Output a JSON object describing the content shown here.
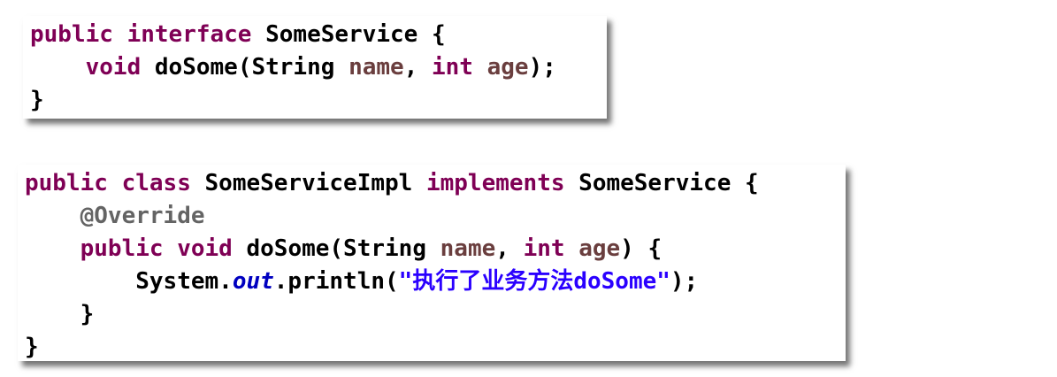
{
  "colors": {
    "keyword": "#7f0055",
    "parameter": "#6a3e3e",
    "annotation": "#646464",
    "static_field": "#0000c0",
    "string": "#2a00ff",
    "plain": "#000000"
  },
  "interface_code": {
    "line1": {
      "kw1": "public",
      "kw2": "interface",
      "rest": " SomeService {"
    },
    "line2": {
      "kw_void": "void",
      "method": " doSome(String ",
      "param1": "name",
      "comma": ", ",
      "kw_int": "int",
      "param2": "age",
      "end": ");"
    },
    "line3": "}"
  },
  "impl_code": {
    "line1": {
      "kw1": "public",
      "kw2": "class",
      "name": " SomeServiceImpl ",
      "kw3": "implements",
      "rest": " SomeService {"
    },
    "line2": "@Override",
    "line3": {
      "kw1": "public",
      "kw2": "void",
      "method": " doSome(String ",
      "param1": "name",
      "comma": ", ",
      "kw_int": "int",
      "param2": "age",
      "end": ") {"
    },
    "line4": {
      "system": "System.",
      "field": "out",
      "println": ".println(",
      "string": "\"执行了业务方法doSome\"",
      "end": ");"
    },
    "line5": "}",
    "line6": "}"
  }
}
